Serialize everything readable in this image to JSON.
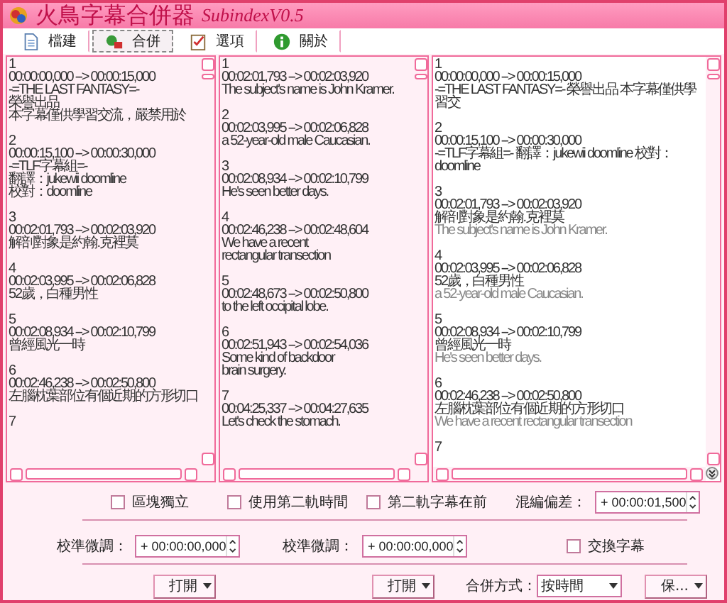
{
  "window": {
    "title": "火鳥字幕合併器",
    "title_suffix": "SubindexV0.5"
  },
  "toolbar": [
    {
      "label": "檔建",
      "selected": false
    },
    {
      "label": "合併",
      "selected": true
    },
    {
      "label": "選項",
      "selected": false
    },
    {
      "label": "關於",
      "selected": false
    }
  ],
  "panes": [
    {
      "entries": [
        {
          "index": "1",
          "time": "00:00:00,000 --> 00:00:15,000",
          "lines": [
            "-=THE LAST FANTASY=-",
            "榮譽出品",
            "本字幕僅供學習交流，嚴禁用於"
          ]
        },
        {
          "index": "2",
          "time": "00:00:15,100 --> 00:00:30,000",
          "lines": [
            "-=TLF字幕組=-",
            "翻譯：jukewii doomline",
            "校對：doomline"
          ]
        },
        {
          "index": "3",
          "time": "00:02:01,793 --> 00:02:03,920",
          "lines": [
            "解剖對象是約翰.克裡莫"
          ]
        },
        {
          "index": "4",
          "time": "00:02:03,995 --> 00:02:06,828",
          "lines": [
            "52歲，白種男性"
          ]
        },
        {
          "index": "5",
          "time": "00:02:08,934 --> 00:02:10,799",
          "lines": [
            "曾經風光一時"
          ]
        },
        {
          "index": "6",
          "time": "00:02:46,238 --> 00:02:50,800",
          "lines": [
            "左腦枕葉部位有個近期的方形切口"
          ]
        },
        {
          "index": "7"
        }
      ]
    },
    {
      "entries": [
        {
          "index": "1",
          "time": "00:02:01,793 --> 00:02:03,920",
          "lines": [
            "The subject's name is John Kramer."
          ]
        },
        {
          "index": "2",
          "time": "00:02:03,995 --> 00:02:06,828",
          "lines": [
            "a 52-year-old male Caucasian."
          ]
        },
        {
          "index": "3",
          "time": "00:02:08,934 --> 00:02:10,799",
          "lines": [
            "He's seen better days."
          ]
        },
        {
          "index": "4",
          "time": "00:02:46,238 --> 00:02:48,604",
          "lines": [
            "We have a recent",
            "rectangular transection"
          ]
        },
        {
          "index": "5",
          "time": "00:02:48,673 --> 00:02:50,800",
          "lines": [
            "to the left occipital lobe."
          ]
        },
        {
          "index": "6",
          "time": "00:02:51,943 --> 00:02:54,036",
          "lines": [
            "Some kind of backdoor",
            "brain surgery."
          ]
        },
        {
          "index": "7",
          "time": "00:04:25,337 --> 00:04:27,635",
          "lines": [
            "Let's check the stomach."
          ]
        }
      ]
    },
    {
      "entries": [
        {
          "index": "1",
          "time": "00:00:00,000 --> 00:00:15,000",
          "lines": [
            "-=THE LAST FANTASY=- 榮譽出品 本字幕僅供學習交"
          ]
        },
        {
          "index": "2",
          "time": "00:00:15,100 --> 00:00:30,000",
          "lines": [
            "-=TLF字幕組=- 翻譯：jukewii doomline 校對：doomline"
          ]
        },
        {
          "index": "3",
          "time": "00:02:01,793 --> 00:02:03,920",
          "lines": [
            "解剖對象是約翰.克裡莫"
          ],
          "secondary_lines": [
            "The subject's name is John Kramer."
          ]
        },
        {
          "index": "4",
          "time": "00:02:03,995 --> 00:02:06,828",
          "lines": [
            "52歲，白種男性"
          ],
          "secondary_lines": [
            "a 52-year-old male Caucasian."
          ]
        },
        {
          "index": "5",
          "time": "00:02:08,934 --> 00:02:10,799",
          "lines": [
            "曾經風光一時"
          ],
          "secondary_lines": [
            "He's seen better days."
          ]
        },
        {
          "index": "6",
          "time": "00:02:46,238 --> 00:02:50,800",
          "lines": [
            "左腦枕葉部位有個近期的方形切口"
          ],
          "secondary_lines": [
            "We have a recent rectangular transection"
          ]
        },
        {
          "index": "7"
        }
      ]
    }
  ],
  "options": {
    "checkboxes": [
      {
        "label": "區塊獨立",
        "checked": false
      },
      {
        "label": "使用第二軌時間",
        "checked": false
      },
      {
        "label": "第二軌字幕在前",
        "checked": false
      }
    ],
    "offset_label": "混編偏差：",
    "offset_value": "+ 00:00:01,500"
  },
  "calibration": [
    {
      "label": "校準微調：",
      "value": "+ 00:00:00,000"
    },
    {
      "label": "校準微調：",
      "value": "+ 00:00:00,000"
    }
  ],
  "swap": {
    "label": "交換字幕",
    "checked": false
  },
  "footer": {
    "open_buttons": [
      "打開",
      "打開"
    ],
    "merge_label": "合併方式：",
    "merge_mode": "按時間",
    "save_button": "保..."
  }
}
